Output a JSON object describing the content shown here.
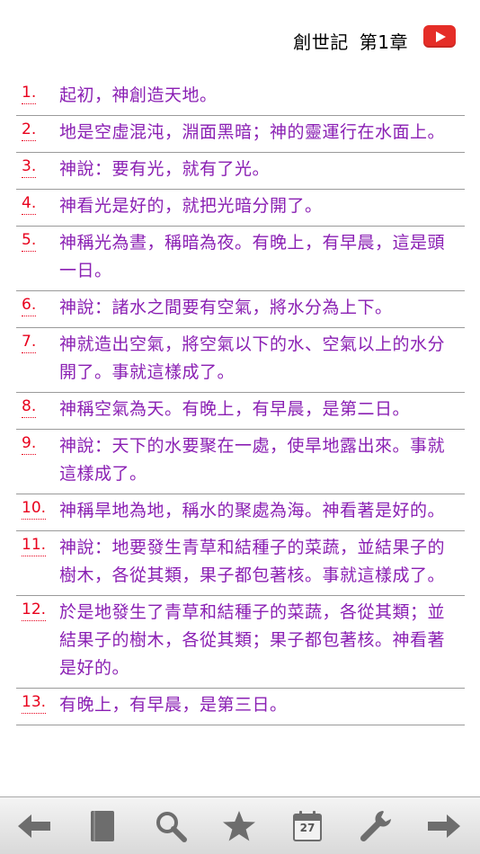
{
  "header": {
    "book": "創世記",
    "chapter": "第1章"
  },
  "verses": [
    {
      "num": "1.",
      "text": "起初，神創造天地。"
    },
    {
      "num": "2.",
      "text": "地是空虛混沌，淵面黑暗；神的靈運行在水面上。"
    },
    {
      "num": "3.",
      "text": "神說：要有光，就有了光。"
    },
    {
      "num": "4.",
      "text": "神看光是好的，就把光暗分開了。"
    },
    {
      "num": "5.",
      "text": "神稱光為晝，稱暗為夜。有晚上，有早晨，這是頭一日。"
    },
    {
      "num": "6.",
      "text": "神說：諸水之間要有空氣，將水分為上下。"
    },
    {
      "num": "7.",
      "text": "神就造出空氣，將空氣以下的水、空氣以上的水分開了。事就這樣成了。"
    },
    {
      "num": "8.",
      "text": "神稱空氣為天。有晚上，有早晨，是第二日。"
    },
    {
      "num": "9.",
      "text": "神說：天下的水要聚在一處，使旱地露出來。事就這樣成了。"
    },
    {
      "num": "10.",
      "text": "神稱旱地為地，稱水的聚處為海。神看著是好的。"
    },
    {
      "num": "11.",
      "text": "神說：地要發生青草和結種子的菜蔬，並結果子的樹木，各從其類，果子都包著核。事就這樣成了。"
    },
    {
      "num": "12.",
      "text": "於是地發生了青草和結種子的菜蔬，各從其類；並結果子的樹木，各從其類；果子都包著核。神看著是好的。"
    },
    {
      "num": "13.",
      "text": "有晚上，有早晨，是第三日。"
    }
  ],
  "toolbar": {
    "calendar_day": "27",
    "icons": [
      "back-arrow-icon",
      "book-icon",
      "search-icon",
      "star-icon",
      "calendar-icon",
      "wrench-icon",
      "forward-arrow-icon"
    ]
  },
  "colors": {
    "verse_number": "#e8001c",
    "verse_text": "#8a1fb3",
    "youtube": "#e52d27",
    "toolbar_icon": "#6d6d6d"
  }
}
